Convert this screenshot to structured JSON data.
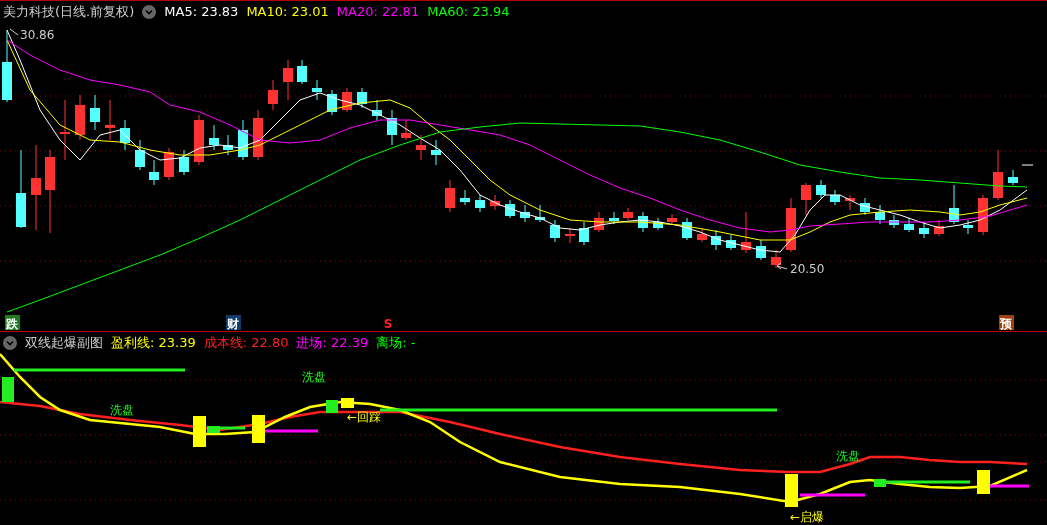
{
  "main_chart": {
    "title": "美力科技(日线.前复权)",
    "indicators": [
      {
        "label": "MA5: 23.83",
        "color": "#ffffff"
      },
      {
        "label": "MA10: 23.01",
        "color": "#ffff00"
      },
      {
        "label": "MA20: 22.81",
        "color": "#ff00ff"
      },
      {
        "label": "MA60: 23.94",
        "color": "#00ff00"
      }
    ],
    "high_label": "30.86",
    "low_label": "20.50",
    "markers": [
      {
        "kind": "box",
        "label": "跌",
        "color": "#1f7a1f"
      },
      {
        "kind": "box",
        "label": "财",
        "color": "#123a6a"
      },
      {
        "kind": "text",
        "label": "S",
        "color": "#ff2020"
      },
      {
        "kind": "box",
        "label": "预",
        "color": "#a04010"
      }
    ]
  },
  "sub_chart": {
    "title": "双线起爆副图",
    "indicators": [
      {
        "label": "盈利线: 23.39",
        "color": "#ffff00"
      },
      {
        "label": "成本线: 22.80",
        "color": "#ff2020"
      },
      {
        "label": "进场: 22.39",
        "color": "#ff00ff"
      },
      {
        "label": "离场: -",
        "color": "#00ff00"
      }
    ],
    "annotations": [
      {
        "kind": "wash",
        "label": "洗盘"
      },
      {
        "kind": "wash",
        "label": "洗盘"
      },
      {
        "kind": "signal",
        "label": "←回踩"
      },
      {
        "kind": "wash",
        "label": "洗盘"
      },
      {
        "kind": "signal",
        "label": "←启爆"
      }
    ]
  }
}
